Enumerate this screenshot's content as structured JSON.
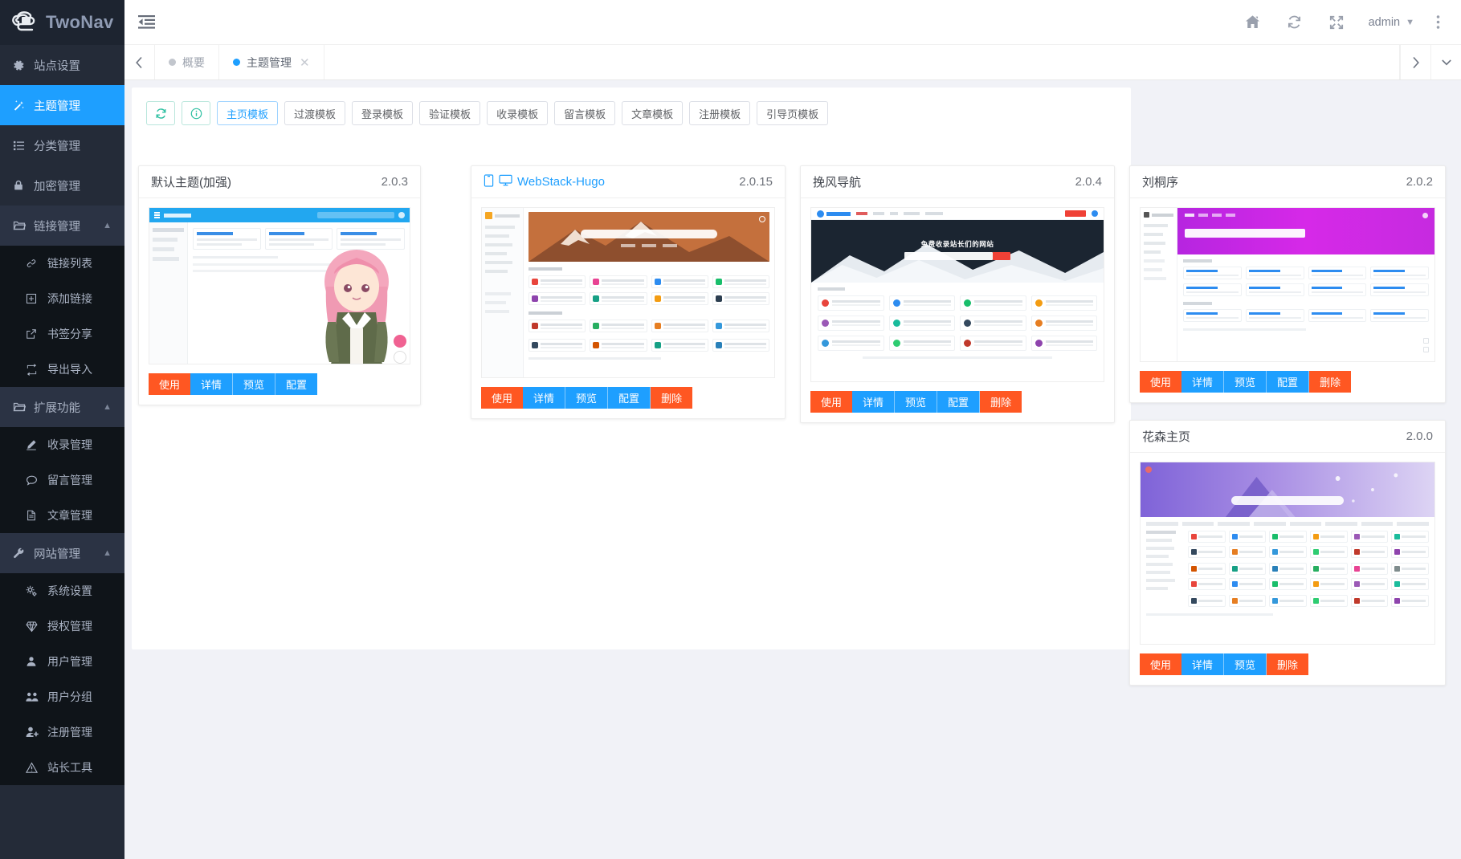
{
  "brand": {
    "name": "TwoNav",
    "logo_icon": "cloud-logo-icon"
  },
  "header": {
    "hamburger_icon": "indent-menu-icon",
    "icons": [
      {
        "name": "home-icon",
        "glyph": "home"
      },
      {
        "name": "refresh-icon",
        "glyph": "refresh"
      },
      {
        "name": "fullscreen-icon",
        "glyph": "fullscreen"
      }
    ],
    "user": "admin",
    "more_icon": "more-vertical-icon"
  },
  "sidebar": {
    "items": [
      {
        "label": "站点设置",
        "icon": "gear-icon",
        "type": "item",
        "active": false
      },
      {
        "label": "主题管理",
        "icon": "magic-wand-icon",
        "type": "item",
        "active": true
      },
      {
        "label": "分类管理",
        "icon": "list-icon",
        "type": "item",
        "active": false
      },
      {
        "label": "加密管理",
        "icon": "lock-icon",
        "type": "item",
        "active": false
      },
      {
        "label": "链接管理",
        "icon": "folder-icon",
        "type": "group",
        "expanded": true,
        "children": [
          {
            "label": "链接列表",
            "icon": "link-icon"
          },
          {
            "label": "添加链接",
            "icon": "plus-square-icon"
          },
          {
            "label": "书签分享",
            "icon": "external-link-icon"
          },
          {
            "label": "导出导入",
            "icon": "exchange-icon"
          }
        ]
      },
      {
        "label": "扩展功能",
        "icon": "folder-icon",
        "type": "group",
        "expanded": true,
        "children": [
          {
            "label": "收录管理",
            "icon": "pencil-icon"
          },
          {
            "label": "留言管理",
            "icon": "comment-icon"
          },
          {
            "label": "文章管理",
            "icon": "document-icon"
          }
        ]
      },
      {
        "label": "网站管理",
        "icon": "wrench-icon",
        "type": "group",
        "expanded": true,
        "children": [
          {
            "label": "系统设置",
            "icon": "cogs-icon"
          },
          {
            "label": "授权管理",
            "icon": "diamond-icon"
          },
          {
            "label": "用户管理",
            "icon": "user-icon"
          },
          {
            "label": "用户分组",
            "icon": "users-icon"
          },
          {
            "label": "注册管理",
            "icon": "user-plus-icon"
          },
          {
            "label": "站长工具",
            "icon": "warning-triangle-icon"
          }
        ]
      }
    ]
  },
  "tabbar": {
    "prev_icon": "chevron-left-icon",
    "next_icon": "chevron-right-icon",
    "dropdown_icon": "chevron-down-icon",
    "tabs": [
      {
        "label": "概要",
        "active": false,
        "closable": false
      },
      {
        "label": "主题管理",
        "active": true,
        "closable": true
      }
    ]
  },
  "toolbar": {
    "refresh_icon": "refresh-icon",
    "info_icon": "info-circle-icon",
    "filters": [
      {
        "label": "主页模板",
        "selected": true
      },
      {
        "label": "过渡模板",
        "selected": false
      },
      {
        "label": "登录模板",
        "selected": false
      },
      {
        "label": "验证模板",
        "selected": false
      },
      {
        "label": "收录模板",
        "selected": false
      },
      {
        "label": "留言模板",
        "selected": false
      },
      {
        "label": "文章模板",
        "selected": false
      },
      {
        "label": "注册模板",
        "selected": false
      },
      {
        "label": "引导页模板",
        "selected": false
      }
    ]
  },
  "themes": [
    {
      "name": "默认主题(加强)",
      "version": "2.0.3",
      "title_is_link": false,
      "icons": [],
      "actions": [
        {
          "label": "使用",
          "style": "orange"
        },
        {
          "label": "详情",
          "style": "blue"
        },
        {
          "label": "预览",
          "style": "blue"
        },
        {
          "label": "配置",
          "style": "blue"
        }
      ]
    },
    {
      "name": "WebStack-Hugo",
      "version": "2.0.15",
      "title_is_link": true,
      "icons": [
        "mobile-icon",
        "desktop-icon"
      ],
      "actions": [
        {
          "label": "使用",
          "style": "orange"
        },
        {
          "label": "详情",
          "style": "blue"
        },
        {
          "label": "预览",
          "style": "blue"
        },
        {
          "label": "配置",
          "style": "blue"
        },
        {
          "label": "删除",
          "style": "delete"
        }
      ]
    },
    {
      "name": "挽风导航",
      "version": "2.0.4",
      "title_is_link": false,
      "icons": [],
      "actions": [
        {
          "label": "使用",
          "style": "orange"
        },
        {
          "label": "详情",
          "style": "blue"
        },
        {
          "label": "预览",
          "style": "blue"
        },
        {
          "label": "配置",
          "style": "blue"
        },
        {
          "label": "删除",
          "style": "delete"
        }
      ]
    },
    {
      "name": "刘桐序",
      "version": "2.0.2",
      "title_is_link": false,
      "icons": [],
      "actions": [
        {
          "label": "使用",
          "style": "orange"
        },
        {
          "label": "详情",
          "style": "blue"
        },
        {
          "label": "预览",
          "style": "blue"
        },
        {
          "label": "配置",
          "style": "blue"
        },
        {
          "label": "删除",
          "style": "delete"
        }
      ]
    },
    {
      "name": "花森主页",
      "version": "2.0.0",
      "title_is_link": false,
      "icons": [],
      "actions": [
        {
          "label": "使用",
          "style": "orange"
        },
        {
          "label": "详情",
          "style": "blue"
        },
        {
          "label": "预览",
          "style": "blue"
        },
        {
          "label": "删除",
          "style": "delete"
        }
      ]
    }
  ],
  "colors": {
    "sidebar_bg": "#242b38",
    "sidebar_sub_bg": "#0f1419",
    "accent_blue": "#1e9fff",
    "accent_orange": "#ff5722",
    "toolbar_teal": "#2bbfa0",
    "content_bg": "#f1f2f7"
  }
}
